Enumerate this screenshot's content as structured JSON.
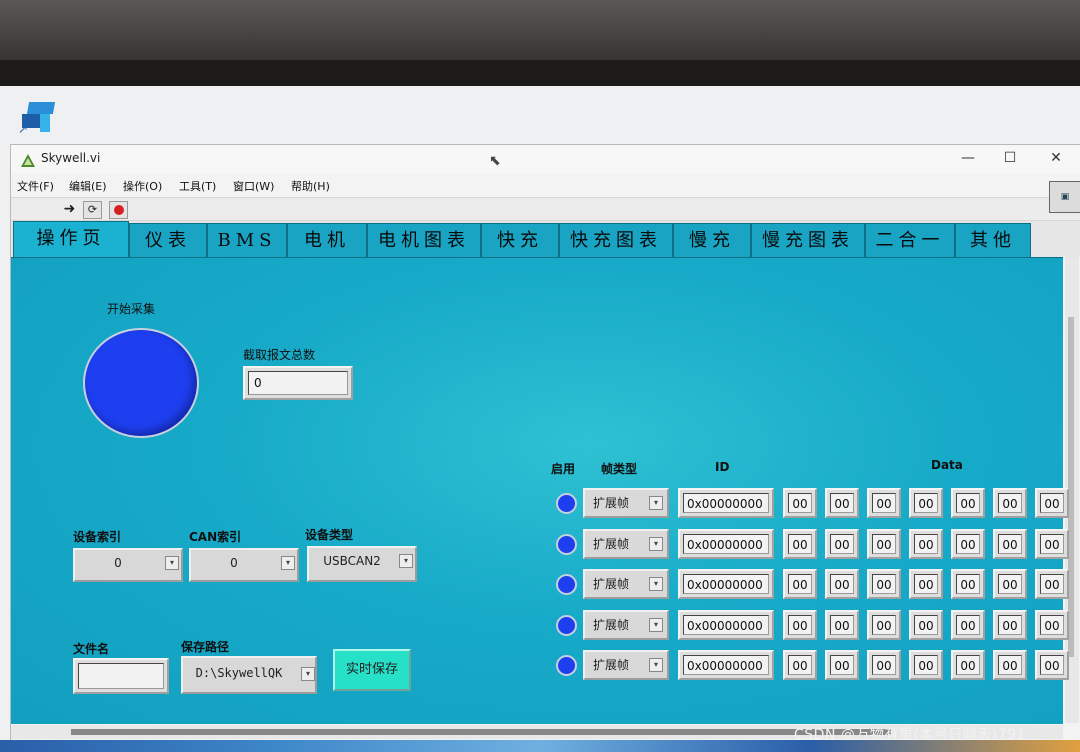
{
  "window": {
    "title": "Skywell.vi",
    "controls": {
      "minimize": "—",
      "maximize": "☐",
      "close": "✕"
    }
  },
  "menu": [
    "文件(F)",
    "编辑(E)",
    "操作(O)",
    "工具(T)",
    "窗口(W)",
    "帮助(H)"
  ],
  "toolbar": {
    "run_icon": "run-arrow-icon",
    "continuous_icon": "run-continuously-icon",
    "stop_icon": "abort-execution-icon"
  },
  "tabs": [
    "操作页",
    "仪表",
    "BMS",
    "电机",
    "电机图表",
    "快充",
    "快充图表",
    "慢充",
    "慢充图表",
    "二合一",
    "其他"
  ],
  "active_tab": 0,
  "left": {
    "start_label": "开始采集",
    "start_led_color": "#1e3ff0",
    "total_label": "截取报文总数",
    "total_value": "0",
    "device_index_label": "设备索引",
    "device_index_value": "0",
    "can_index_label": "CAN索引",
    "can_index_value": "0",
    "device_type_label": "设备类型",
    "device_type_value": "USBCAN2",
    "filename_label": "文件名",
    "filename_value": "",
    "save_path_label": "保存路径",
    "save_path_value": "D:\\SkywellQK",
    "realtime_save_label": "实时保存"
  },
  "send_table": {
    "headers": {
      "enable": "启用",
      "frame_type": "帧类型",
      "id": "ID",
      "data": "Data"
    },
    "rows": [
      {
        "frame": "扩展帧",
        "id": "0x00000000",
        "data": [
          "00",
          "00",
          "00",
          "00",
          "00",
          "00",
          "00"
        ]
      },
      {
        "frame": "扩展帧",
        "id": "0x00000000",
        "data": [
          "00",
          "00",
          "00",
          "00",
          "00",
          "00",
          "00"
        ]
      },
      {
        "frame": "扩展帧",
        "id": "0x00000000",
        "data": [
          "00",
          "00",
          "00",
          "00",
          "00",
          "00",
          "00"
        ]
      },
      {
        "frame": "扩展帧",
        "id": "0x00000000",
        "data": [
          "00",
          "00",
          "00",
          "00",
          "00",
          "00",
          "00"
        ]
      },
      {
        "frame": "扩展帧",
        "id": "0x00000000",
        "data": [
          "00",
          "00",
          "00",
          "00",
          "00",
          "00",
          "00"
        ]
      }
    ]
  },
  "watermark": "CSDN @万物有里(本号只聊天)791"
}
